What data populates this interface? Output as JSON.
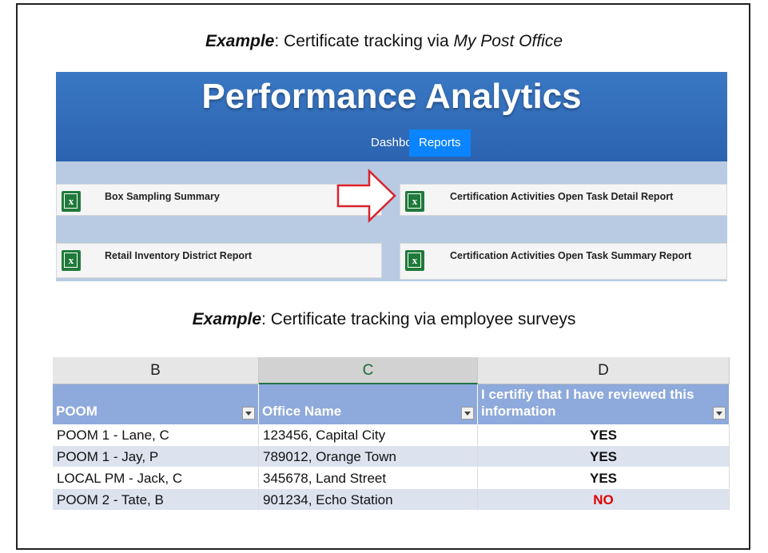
{
  "captions": {
    "top": {
      "bold": "Example",
      "sep": ": ",
      "plain": "Certificate tracking via ",
      "italic": "My Post Office"
    },
    "middle": {
      "bold": "Example",
      "sep": ": ",
      "plain": "Certificate tracking via employee surveys"
    }
  },
  "analytics": {
    "title": "Performance Analytics",
    "nav": [
      "Dashboard",
      "Reports"
    ],
    "active_nav": "Reports",
    "tiles": [
      {
        "label": "Box Sampling Summary",
        "icon": "excel-icon"
      },
      {
        "label": "Certification Activities Open Task Detail Report",
        "icon": "excel-icon"
      },
      {
        "label": "Retail Inventory District Report",
        "icon": "excel-icon"
      },
      {
        "label": "Certification Activities Open Task Summary Report",
        "icon": "excel-icon"
      }
    ],
    "icon_glyph": "x",
    "arrow_icon": "right-arrow-icon",
    "arrow_color": "#d9232d"
  },
  "sheet": {
    "columns": [
      "B",
      "C",
      "D"
    ],
    "selected_column": "C",
    "headers": [
      "POOM",
      "Office Name",
      "I certifiy that I have reviewed this information"
    ],
    "rows": [
      [
        "POOM 1 - Lane, C",
        "123456, Capital City",
        "YES"
      ],
      [
        "POOM 1 - Jay, P",
        "789012, Orange Town",
        "YES"
      ],
      [
        "LOCAL PM - Jack, C",
        "345678, Land Street",
        "YES"
      ],
      [
        "POOM 2 - Tate, B",
        "901234, Echo Station",
        "NO"
      ]
    ],
    "colors": {
      "header_bg": "#8ea9db",
      "band": "#dce3ef",
      "no_text": "#e00000"
    }
  }
}
